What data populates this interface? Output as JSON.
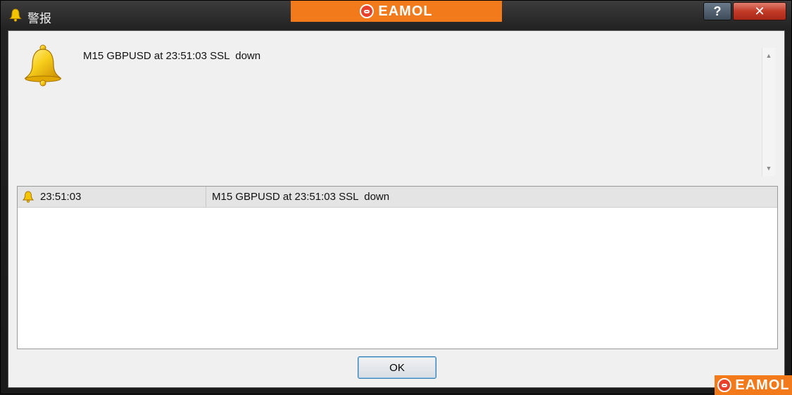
{
  "window": {
    "title": "警报",
    "help_label": "?",
    "close_label": "✕"
  },
  "brand": {
    "name": "EAMOL"
  },
  "alert": {
    "message": "M15 GBPUSD at 23:51:03 SSL  down"
  },
  "alert_list": {
    "rows": [
      {
        "time": "23:51:03",
        "message": "M15 GBPUSD at 23:51:03 SSL  down"
      }
    ]
  },
  "buttons": {
    "ok_label": "OK"
  },
  "icons": {
    "bell": "bell-icon",
    "scroll_up": "scroll-up-arrow-icon",
    "scroll_down": "scroll-down-arrow-icon",
    "help": "help-icon",
    "close": "close-icon",
    "brand_mark": "eamol-logo-icon"
  },
  "colors": {
    "brand_orange": "#f27a1a",
    "close_red": "#c23a28",
    "dialog_bg": "#f0f0f0",
    "bell_gold": "#f5c400"
  }
}
